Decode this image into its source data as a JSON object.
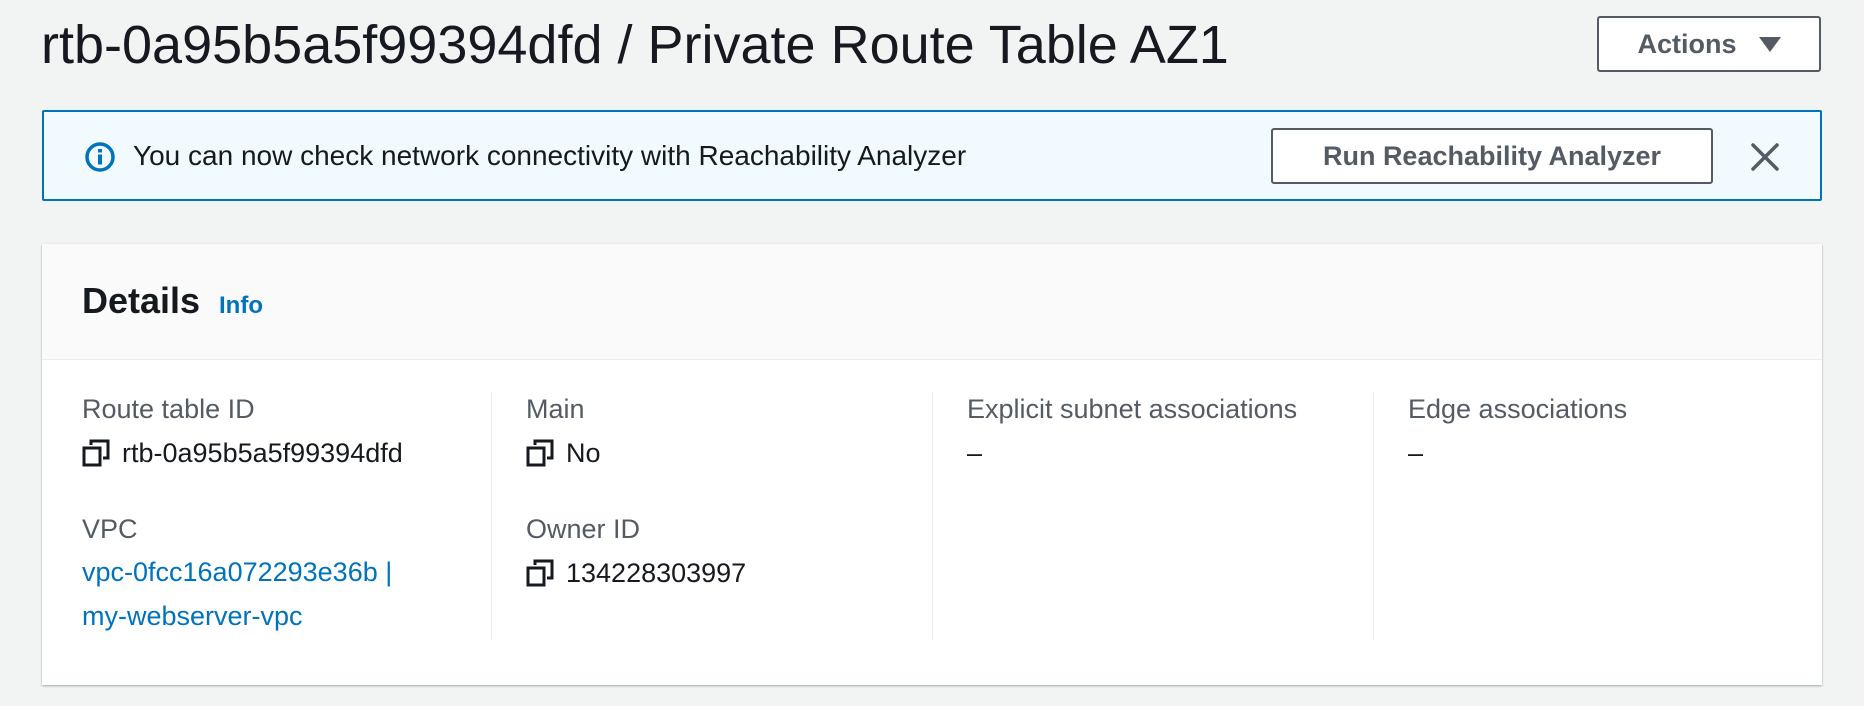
{
  "header": {
    "title": "rtb-0a95b5a5f99394dfd / Private Route Table AZ1",
    "actions_label": "Actions"
  },
  "flash": {
    "icon": "info-circle-icon",
    "message": "You can now check network connectivity with Reachability Analyzer",
    "button_label": "Run Reachability Analyzer",
    "close_icon": "close-icon"
  },
  "details": {
    "title": "Details",
    "info_label": "Info",
    "route_table_id": {
      "label": "Route table ID",
      "value": "rtb-0a95b5a5f99394dfd"
    },
    "vpc": {
      "label": "VPC",
      "line1": "vpc-0fcc16a072293e36b |",
      "line2": "my-webserver-vpc"
    },
    "main": {
      "label": "Main",
      "value": "No"
    },
    "owner_id": {
      "label": "Owner ID",
      "value": "134228303997"
    },
    "explicit_subnet_associations": {
      "label": "Explicit subnet associations",
      "value": "–"
    },
    "edge_associations": {
      "label": "Edge associations",
      "value": "–"
    }
  },
  "colors": {
    "link": "#0073bb",
    "info_background": "#f1faff",
    "page_background": "#f2f3f3"
  }
}
